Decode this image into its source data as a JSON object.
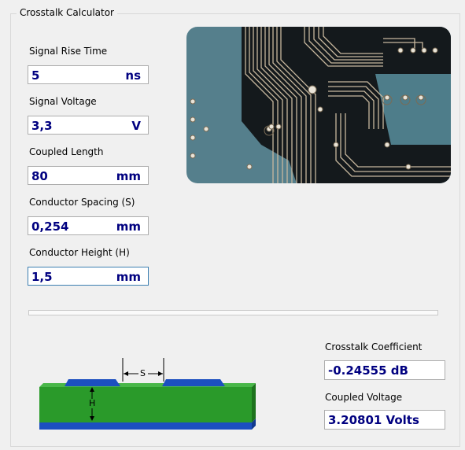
{
  "group_title": "Crosstalk Calculator",
  "inputs": [
    {
      "label": "Signal Rise Time",
      "value": "5",
      "unit": "ns"
    },
    {
      "label": "Signal Voltage",
      "value": "3,3",
      "unit": "V"
    },
    {
      "label": "Coupled Length",
      "value": "80",
      "unit": "mm"
    },
    {
      "label": "Conductor Spacing (S)",
      "value": "0,254",
      "unit": "mm"
    },
    {
      "label": "Conductor Height (H)",
      "value": "1,5",
      "unit": "mm"
    }
  ],
  "results": {
    "crosstalk_label": "Crosstalk Coefficient",
    "crosstalk_value": "-0.24555 dB",
    "voltage_label": "Coupled Voltage",
    "voltage_value": "3.20801 Volts"
  },
  "diagram": {
    "spacing_label": "S",
    "height_label": "H"
  },
  "colors": {
    "value_text": "#000080",
    "pcb_board": "#4f8090",
    "substrate": "#2a9a2a",
    "ground": "#1c4fc0",
    "trace": "#1c4fc0"
  }
}
